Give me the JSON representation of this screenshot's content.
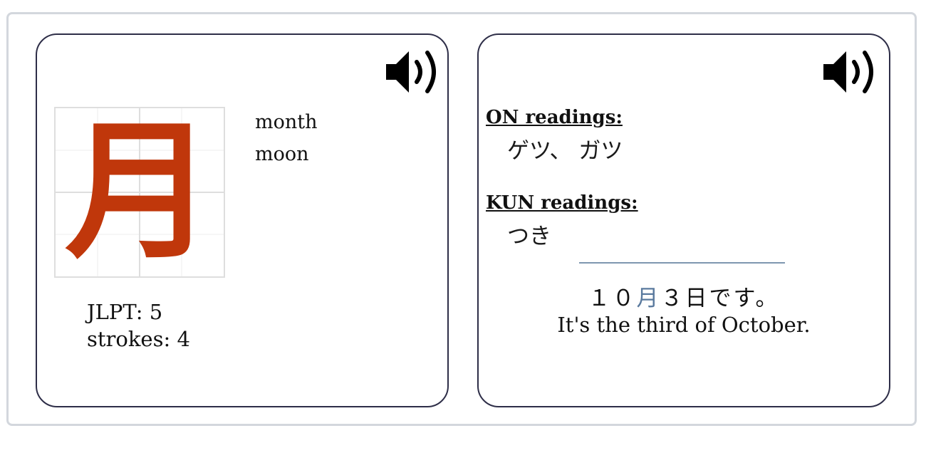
{
  "kanji_card": {
    "character": "月",
    "meanings": [
      "month",
      "moon"
    ],
    "jlpt": "JLPT: 5",
    "strokes": "strokes: 4",
    "speaker_icon": "speaker-icon"
  },
  "readings_card": {
    "on_label": "ON readings:",
    "on_value": "ゲツ、 ガツ",
    "kun_label": "KUN readings:",
    "kun_value": "つき",
    "speaker_icon": "speaker-icon",
    "example_before": "１０",
    "example_highlight": "月",
    "example_after": "３日です。",
    "example_translation": "It's the third of October."
  },
  "colors": {
    "kanji": "#c0370b",
    "highlight": "#5a7a9e",
    "card_border": "#2e2e48",
    "frame_border": "#d3d7dd"
  }
}
